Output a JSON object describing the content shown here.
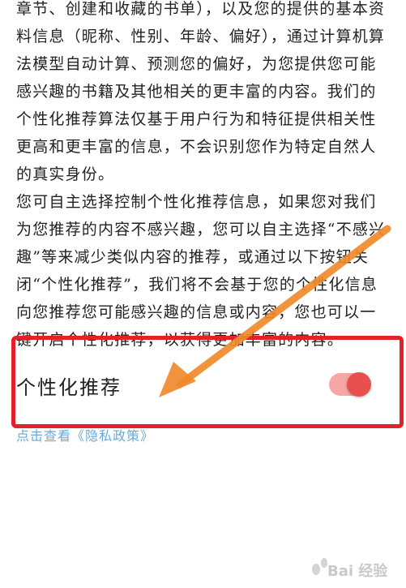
{
  "paragraphs": [
    "章节、创建和收藏的书单），以及您的提供的基本资料信息（昵称、性别、年龄、偏好），通过计算机算法模型自动计算、预测您的偏好，为您提供您可能感兴趣的书籍及其他相关的更丰富的内容。我们的个性化推荐算法仅基于用户行为和特征提供相关性更高和更丰富的信息，不会识别您作为特定自然人的真实身份。",
    "您可自主选择控制个性化推荐信息，如果您对我们为您推荐的内容不感兴趣，您可以自主选择“不感兴趣”等来减少类似内容的推荐，或通过以下按钮关闭“个性化推荐”，我们将不会基于您的个性化信息向您推荐您可能感兴趣的信息或内容，您也可以一键开启个性化推荐，以获得更加丰富的内容。"
  ],
  "setting": {
    "title": "个性化推荐",
    "enabled": true
  },
  "privacy_link": "点击查看《隐私政策》",
  "watermark": "Bai 经验",
  "colors": {
    "toggle_track": "#f6a7a5",
    "toggle_knob": "#e8504f",
    "highlight": "#e3212a",
    "arrow": "#f08a2c",
    "link": "#6aa8d8"
  }
}
